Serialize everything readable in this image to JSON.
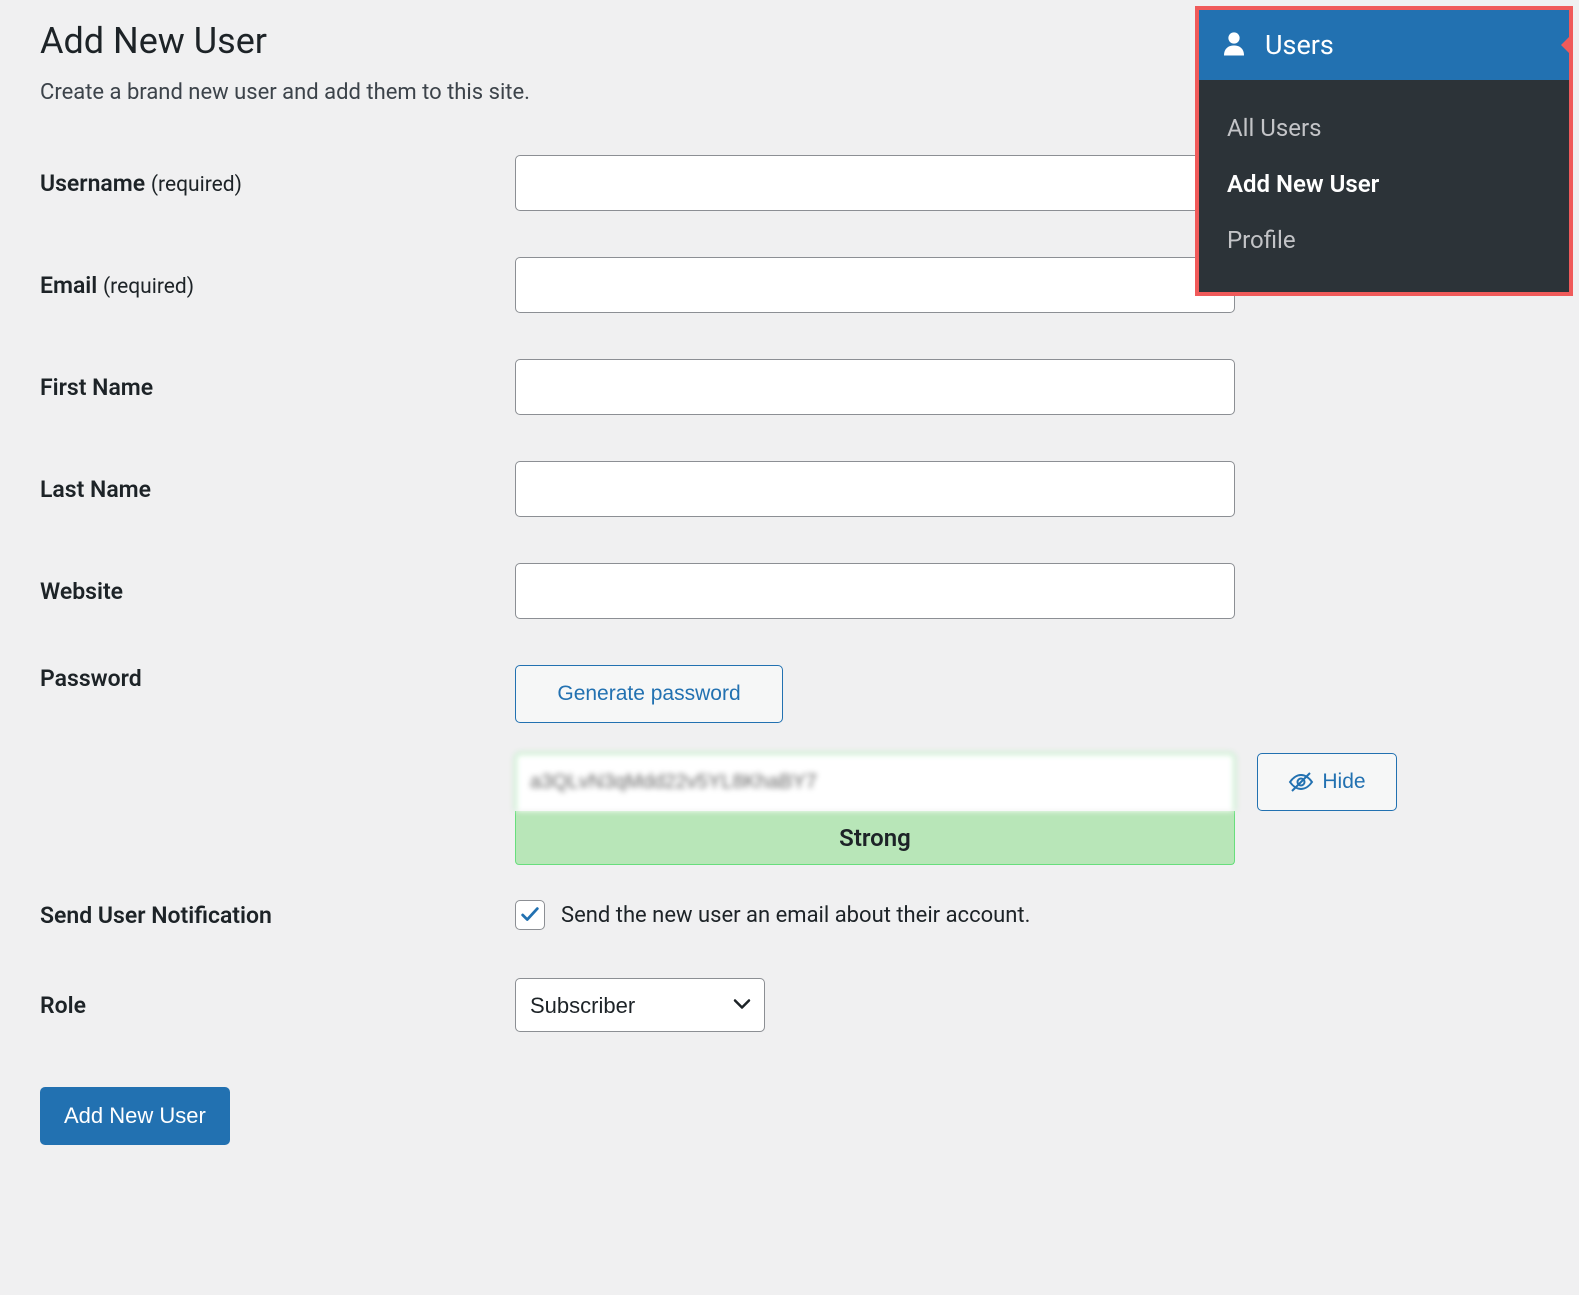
{
  "page": {
    "title": "Add New User",
    "subtitle": "Create a brand new user and add them to this site."
  },
  "form": {
    "username_label": "Username",
    "username_required": "(required)",
    "username_value": "",
    "email_label": "Email",
    "email_required": "(required)",
    "email_value": "",
    "firstname_label": "First Name",
    "firstname_value": "",
    "lastname_label": "Last Name",
    "lastname_value": "",
    "website_label": "Website",
    "website_value": "",
    "password_label": "Password",
    "generate_button": "Generate password",
    "password_value": "a3QLvN3qMdd22v5YL8KhaBY7",
    "strength_label": "Strong",
    "hide_button": "Hide",
    "notification_label": "Send User Notification",
    "notification_checkbox_label": "Send the new user an email about their account.",
    "notification_checked": true,
    "role_label": "Role",
    "role_selected": "Subscriber",
    "submit_button": "Add New User"
  },
  "sidebar": {
    "header": "Users",
    "items": [
      {
        "label": "All Users",
        "active": false
      },
      {
        "label": "Add New User",
        "active": true
      },
      {
        "label": "Profile",
        "active": false
      }
    ]
  }
}
